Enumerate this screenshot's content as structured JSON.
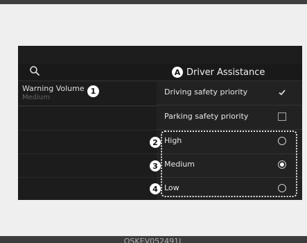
{
  "header": {
    "title": "Driver Assistance",
    "title_marker": "A"
  },
  "left": {
    "items": [
      {
        "title": "Warning Volume",
        "value": "Medium",
        "marker": "1"
      }
    ]
  },
  "right": {
    "options": [
      {
        "label": "Driving safety priority",
        "control": "checkbox",
        "checked": true
      },
      {
        "label": "Parking safety priority",
        "control": "checkbox",
        "checked": false
      },
      {
        "label": "High",
        "control": "radio",
        "selected": false,
        "marker": "2"
      },
      {
        "label": "Medium",
        "control": "radio",
        "selected": true,
        "marker": "3"
      },
      {
        "label": "Low",
        "control": "radio",
        "selected": false,
        "marker": "4"
      }
    ]
  },
  "caption": "OSKEV052491L",
  "icons": {
    "search": "search-icon",
    "checkmark": "checkmark-icon"
  },
  "colors": {
    "screen_bg": "#191919",
    "text": "#e6e6e6",
    "muted": "#646464"
  }
}
